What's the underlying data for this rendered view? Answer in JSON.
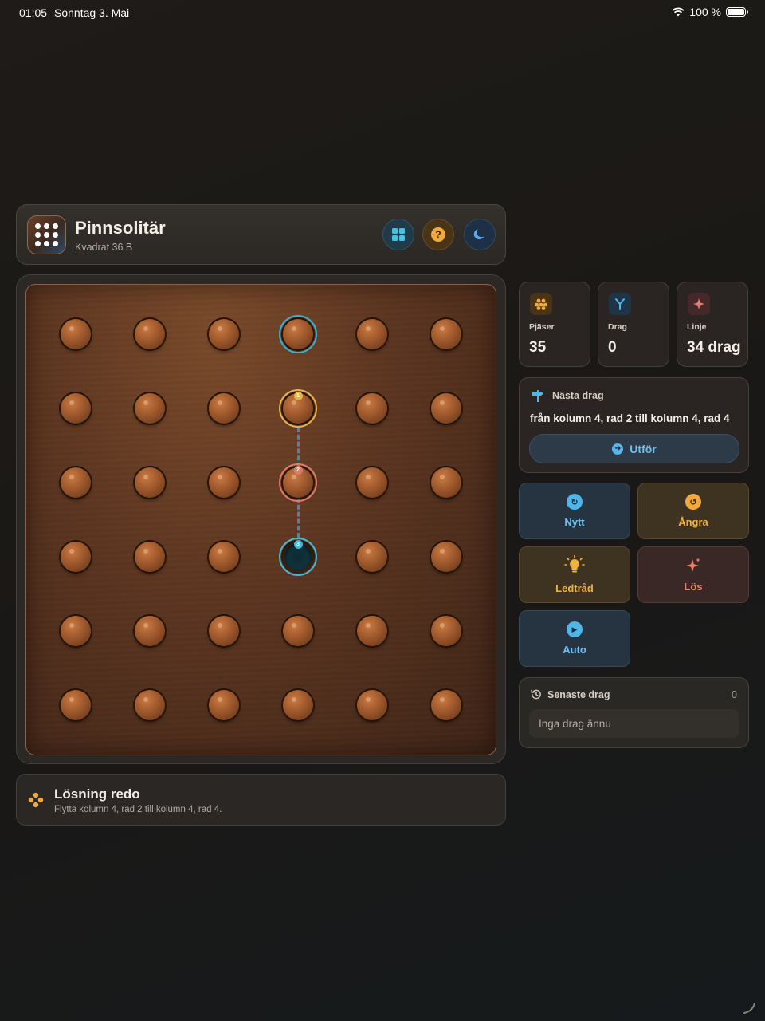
{
  "status_bar": {
    "time": "01:05",
    "date": "Sonntag 3. Mai",
    "battery": "100 %"
  },
  "header": {
    "title": "Pinnsolitär",
    "subtitle": "Kvadrat 36 B",
    "icons": [
      "grid-icon",
      "help-icon",
      "moon-icon"
    ]
  },
  "board": {
    "rows": 6,
    "cols": 6,
    "empty_holes": [
      [
        3,
        3
      ]
    ],
    "highlights": [
      {
        "row": 0,
        "col": 3,
        "role": "selected",
        "color": "#3bb0d0"
      },
      {
        "row": 1,
        "col": 3,
        "role": "from",
        "step": "1",
        "color": "#e6b24a"
      },
      {
        "row": 2,
        "col": 3,
        "role": "over",
        "step": "2",
        "color": "#e07a6a"
      },
      {
        "row": 3,
        "col": 3,
        "role": "to",
        "step": "3",
        "color": "#43b8d6"
      }
    ]
  },
  "solution": {
    "title": "Lösning redo",
    "text": "Flytta kolumn 4, rad 2 till kolumn 4, rad 4."
  },
  "stats": [
    {
      "label": "Pjäser",
      "value": "35",
      "icon": "pegs-icon",
      "color": "#f2a93b"
    },
    {
      "label": "Drag",
      "value": "0",
      "icon": "branch-icon",
      "color": "#4fb6e8"
    },
    {
      "label": "Linje",
      "value": "34 drag",
      "icon": "sparkle-icon",
      "color": "#f07a6a"
    }
  ],
  "next_move": {
    "heading": "Nästa drag",
    "description": "från kolumn 4, rad 2 till kolumn 4, rad 4",
    "button": "Utför"
  },
  "actions": {
    "new": "Nytt",
    "undo": "Ångra",
    "hint": "Ledtråd",
    "solve": "Lös",
    "auto": "Auto"
  },
  "recent": {
    "title": "Senaste drag",
    "count": "0",
    "empty": "Inga drag ännu"
  },
  "colors": {
    "accent_blue": "#4fb6e8",
    "accent_yellow": "#f2a93b",
    "accent_red": "#f07a6a",
    "peg": "#a85f30"
  }
}
